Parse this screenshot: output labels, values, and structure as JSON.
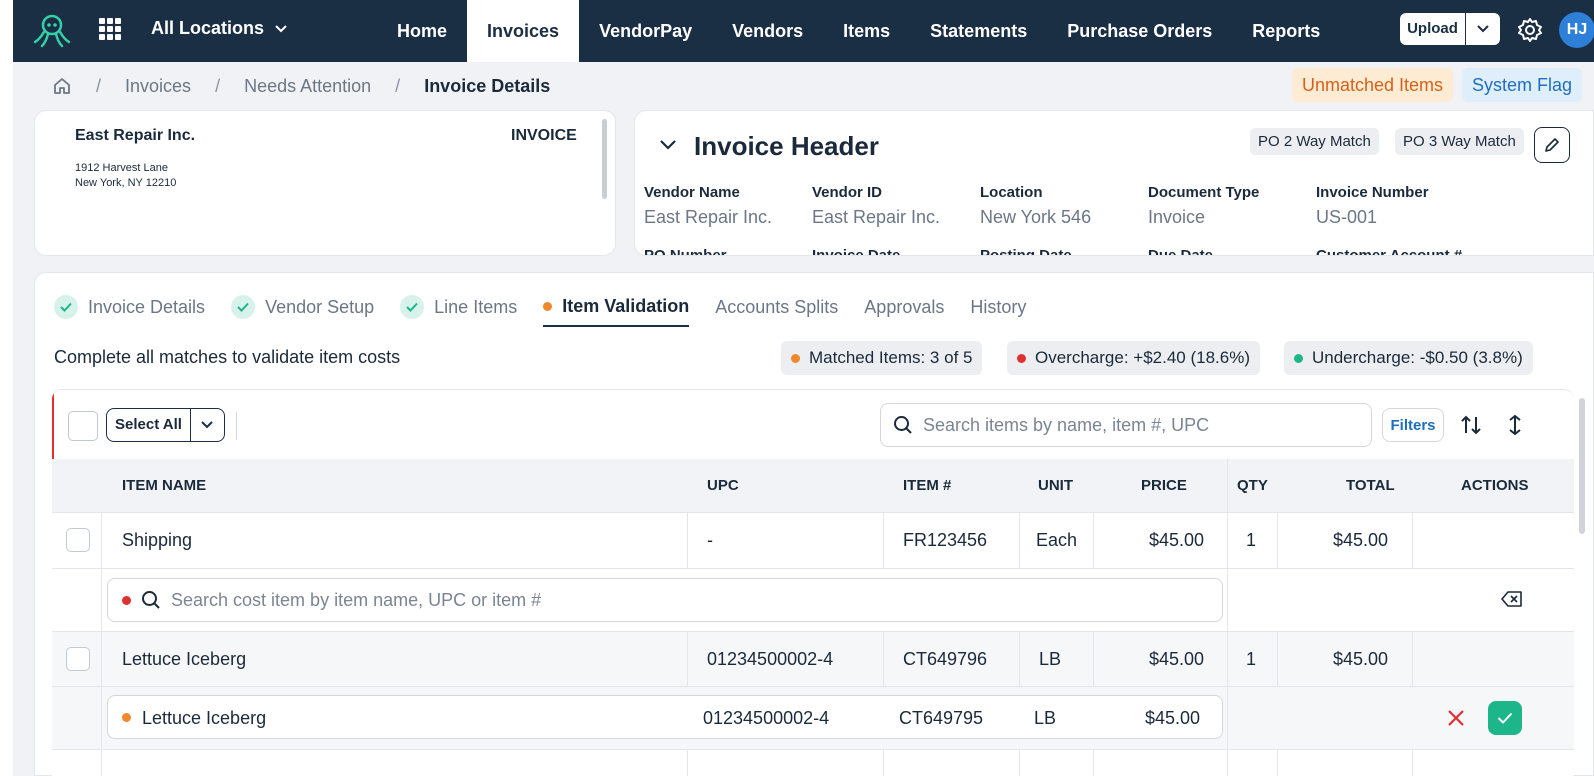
{
  "nav": {
    "location": "All Locations",
    "tabs": [
      {
        "label": "Home"
      },
      {
        "label": "Invoices"
      },
      {
        "label": "VendorPay"
      },
      {
        "label": "Vendors"
      },
      {
        "label": "Items"
      },
      {
        "label": "Statements"
      },
      {
        "label": "Purchase Orders"
      },
      {
        "label": "Reports"
      }
    ],
    "active_tab": "Invoices",
    "upload_label": "Upload",
    "avatar_initials": "HJ"
  },
  "breadcrumb": {
    "items": [
      "Invoices",
      "Needs Attention"
    ],
    "current": "Invoice Details"
  },
  "flags": {
    "unmatched": "Unmatched Items",
    "system": "System Flag"
  },
  "preview": {
    "company": "East Repair Inc.",
    "doc_label": "INVOICE",
    "address_line1": "1912 Harvest Lane",
    "address_line2": "New York, NY 12210"
  },
  "header": {
    "title": "Invoice Header",
    "tags": [
      "PO 2 Way Match",
      "PO 3 Way Match"
    ],
    "fields": [
      {
        "label": "Vendor Name",
        "value": "East Repair Inc."
      },
      {
        "label": "Vendor ID",
        "value": "East Repair Inc."
      },
      {
        "label": "Location",
        "value": "New York 546"
      },
      {
        "label": "Document Type",
        "value": "Invoice"
      },
      {
        "label": "Invoice Number",
        "value": "US-001"
      }
    ],
    "fields_row2": [
      "PO Number",
      "Invoice Date",
      "Posting Date",
      "Due Date",
      "Customer Account #"
    ]
  },
  "steps": {
    "tabs": [
      {
        "label": "Invoice Details"
      },
      {
        "label": "Vendor Setup"
      },
      {
        "label": "Line Items"
      },
      {
        "label": "Item Validation"
      },
      {
        "label": "Accounts Splits"
      },
      {
        "label": "Approvals"
      },
      {
        "label": "History"
      }
    ]
  },
  "validation": {
    "instruction": "Complete all matches to validate item costs",
    "matched": "Matched Items: 3 of 5",
    "overcharge": "Overcharge: +$2.40 (18.6%)",
    "undercharge": "Undercharge: -$0.50 (3.8%)"
  },
  "toolbar": {
    "select_all": "Select All",
    "search_placeholder": "Search items by name, item #, UPC",
    "filters": "Filters"
  },
  "table": {
    "columns": [
      "ITEM NAME",
      "UPC",
      "ITEM #",
      "UNIT",
      "PRICE",
      "QTY",
      "TOTAL",
      "ACTIONS"
    ],
    "rows": [
      {
        "name": "Shipping",
        "upc": "-",
        "item": "FR123456",
        "unit": "Each",
        "price": "$45.00",
        "qty": "1",
        "total": "$45.00"
      },
      {
        "name": "Lettuce Iceberg",
        "upc": "01234500002-4",
        "item": "CT649796",
        "unit": "LB",
        "price": "$45.00",
        "qty": "1",
        "total": "$45.00"
      }
    ],
    "cost_search_placeholder": "Search cost item by item name, UPC or item #",
    "match": {
      "name": "Lettuce Iceberg",
      "upc": "01234500002-4",
      "item": "CT649795",
      "unit": "LB",
      "price": "$45.00"
    }
  },
  "colors": {
    "nav_bg": "#1a2e44",
    "accent_orange": "#f0882c",
    "accent_red": "#e03131",
    "accent_green": "#1db58a",
    "link_blue": "#1f6fbf"
  }
}
